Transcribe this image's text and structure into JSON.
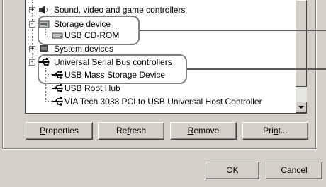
{
  "tree": {
    "items": [
      {
        "label": "Sound, video and game controllers",
        "icon": "speaker-icon",
        "level": 0,
        "expander": "+"
      },
      {
        "label": "Storage device",
        "icon": "storage-device-icon",
        "level": 0,
        "expander": "-"
      },
      {
        "label": "USB CD-ROM",
        "icon": "cdrom-drive-icon",
        "level": 1
      },
      {
        "label": "System devices",
        "icon": "system-devices-icon",
        "level": 0,
        "expander": "+"
      },
      {
        "label": "Universal Serial Bus controllers",
        "icon": "usb-icon",
        "level": 0,
        "expander": "-"
      },
      {
        "label": "USB Mass Storage Device",
        "icon": "usb-icon",
        "level": 1
      },
      {
        "label": "USB Root Hub",
        "icon": "usb-icon",
        "level": 1
      },
      {
        "label": "VIA Tech 3038 PCI to USB Universal Host Controller",
        "icon": "usb-icon",
        "level": 1
      }
    ]
  },
  "buttons": {
    "properties": {
      "pre": "",
      "key": "P",
      "post": "roperties"
    },
    "refresh": {
      "pre": "Re",
      "key": "f",
      "post": "resh"
    },
    "remove": {
      "pre": "",
      "key": "R",
      "post": "emove"
    },
    "print": {
      "pre": "Pri",
      "key": "n",
      "post": "t..."
    },
    "ok": "OK",
    "cancel": "Cancel"
  },
  "colors": {
    "face": "#d4d0c8",
    "callout_border": "#808080",
    "leader_line": "#5a5a5a"
  }
}
